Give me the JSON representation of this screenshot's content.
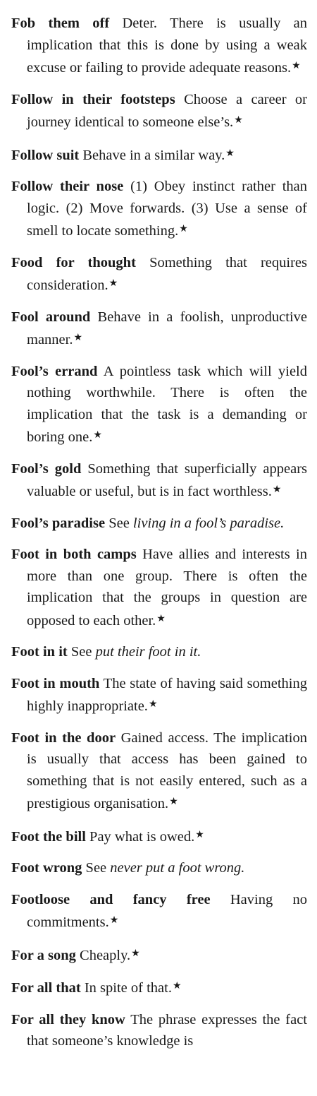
{
  "entries": [
    {
      "term": "Fob them off",
      "definition": "Deter. There is usually an implication that this is done by using a weak excuse or failing to provide adequate reasons.",
      "marker": "★"
    },
    {
      "term": "Follow in their footsteps",
      "definition": "Choose a career or journey identical to someone else’s.",
      "marker": "★"
    },
    {
      "term": "Follow suit",
      "definition": "Behave in a similar way.",
      "marker": "★"
    },
    {
      "term": "Follow their nose",
      "definition": "(1) Obey instinct rather than logic. (2) Move forwards. (3) Use a sense of smell to locate something.",
      "marker": "★"
    },
    {
      "term": "Food for thought",
      "definition": "Something that requires consideration.",
      "marker": "★"
    },
    {
      "term": "Fool around",
      "definition": "Behave in a foolish, unpro­ductive manner.",
      "marker": "★"
    },
    {
      "term": "Fool’s errand",
      "definition": "A pointless task which will yield nothing worthwhile. There is often the implication that the task is a demand­ing or boring one.",
      "marker": "★"
    },
    {
      "term": "Fool’s gold",
      "definition": "Something that superficially appears valuable or useful, but is in fact worthless.",
      "marker": "★"
    },
    {
      "term": "Fool’s paradise",
      "see_label": "See",
      "see_ref": "living in a fool’s paradise."
    },
    {
      "term": "Foot in both camps",
      "definition": "Have allies and inter­ests in more than one group. There is often the implication that the groups in question are opposed to each other.",
      "marker": "★"
    },
    {
      "term": "Foot in it",
      "see_label": "See",
      "see_ref": "put their foot in it."
    },
    {
      "term": "Foot in mouth",
      "definition": "The state of having said something highly inappropriate.",
      "marker": "★"
    },
    {
      "term": "Foot in the door",
      "definition": "Gained access. The implication is usually that access has been gained to something that is not easily entered, such as a prestigious organisa­tion.",
      "marker": "★"
    },
    {
      "term": "Foot the bill",
      "definition": "Pay what is owed.",
      "marker": "★"
    },
    {
      "term": "Foot wrong",
      "see_label": "See",
      "see_ref": "never put a foot wrong."
    },
    {
      "term": "Footloose and fancy free",
      "definition": "Having no commitments.",
      "marker": "★"
    },
    {
      "term": "For a song",
      "definition": "Cheaply.",
      "marker": "★"
    },
    {
      "term": "For all that",
      "definition": "In spite of that.",
      "marker": "★"
    },
    {
      "term": "For all they know",
      "definition": "The phrase expresses the fact that someone’s knowledge is",
      "marker": ""
    }
  ]
}
